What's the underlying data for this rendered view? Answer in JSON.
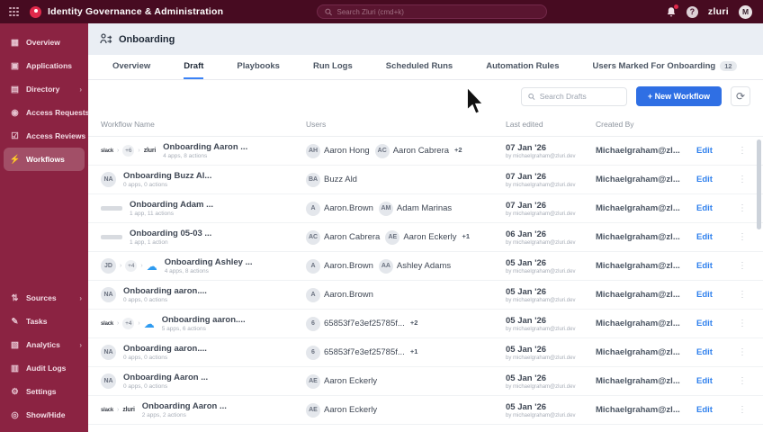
{
  "colors": {
    "topbar": "#470b21",
    "sidebar": "#8b2342",
    "accent_blue": "#2f6fe4",
    "link_blue": "#2f80ed",
    "page_bg": "#eaeef4"
  },
  "topbar": {
    "title": "Identity Governance & Administration",
    "search_placeholder": "Search Zluri (cmd+k)",
    "logo_text": "zluri",
    "avatar_initial": "M"
  },
  "sidebar": {
    "items_top": [
      {
        "label": "Overview",
        "icon": "overview",
        "chevron": false,
        "active": false
      },
      {
        "label": "Applications",
        "icon": "applications",
        "chevron": false,
        "active": false
      },
      {
        "label": "Directory",
        "icon": "directory",
        "chevron": true,
        "active": false
      },
      {
        "label": "Access Requests",
        "icon": "access-requests",
        "chevron": false,
        "active": false
      },
      {
        "label": "Access Reviews",
        "icon": "access-reviews",
        "chevron": false,
        "active": false
      },
      {
        "label": "Workflows",
        "icon": "workflows",
        "chevron": false,
        "active": true
      }
    ],
    "items_bottom": [
      {
        "label": "Sources",
        "icon": "sources",
        "chevron": true,
        "active": false
      },
      {
        "label": "Tasks",
        "icon": "tasks",
        "chevron": false,
        "active": false
      },
      {
        "label": "Analytics",
        "icon": "analytics",
        "chevron": true,
        "active": false
      },
      {
        "label": "Audit Logs",
        "icon": "audit-logs",
        "chevron": false,
        "active": false
      },
      {
        "label": "Settings",
        "icon": "settings",
        "chevron": false,
        "active": false
      },
      {
        "label": "Show/Hide",
        "icon": "show-hide",
        "chevron": false,
        "active": false
      }
    ]
  },
  "page": {
    "title": "Onboarding"
  },
  "tabs": [
    {
      "label": "Overview",
      "active": false
    },
    {
      "label": "Draft",
      "active": true
    },
    {
      "label": "Playbooks",
      "active": false
    },
    {
      "label": "Run Logs",
      "active": false
    },
    {
      "label": "Scheduled Runs",
      "active": false
    },
    {
      "label": "Automation Rules",
      "active": false
    },
    {
      "label": "Users Marked For Onboarding",
      "active": false,
      "badge": "12"
    }
  ],
  "toolbar": {
    "search_placeholder": "Search Drafts",
    "new_workflow_label": "+ New Workflow"
  },
  "table": {
    "columns": [
      "Workflow Name",
      "Users",
      "Last edited",
      "Created By"
    ],
    "edit_label": "Edit",
    "rows": [
      {
        "icons": [
          {
            "t": "wordmark",
            "v": "slack"
          },
          {
            "t": "chev"
          },
          {
            "t": "count",
            "v": "+6"
          },
          {
            "t": "chev"
          },
          {
            "t": "wordmark",
            "v": "zluri"
          }
        ],
        "name": "Onboarding Aaron ...",
        "sub": "4 apps, 8 actions",
        "users": [
          {
            "i": "AH",
            "n": "Aaron Hong"
          },
          {
            "i": "AC",
            "n": "Aaron Cabrera"
          }
        ],
        "extra": "+2",
        "date": "07 Jan '26",
        "date_sub": "by michaelgraham@zluri.dev",
        "created_by": "Michaelgraham@zl..."
      },
      {
        "icons": [
          {
            "t": "avatar",
            "v": "NA"
          }
        ],
        "name": "Onboarding Buzz Al...",
        "sub": "0 apps, 0 actions",
        "users": [
          {
            "i": "BA",
            "n": "Buzz Ald"
          }
        ],
        "extra": "",
        "date": "07 Jan '26",
        "date_sub": "by michaelgraham@zluri.dev",
        "created_by": "Michaelgraham@zl..."
      },
      {
        "icons": [
          {
            "t": "blur"
          }
        ],
        "name": "Onboarding Adam ...",
        "sub": "1 app, 11 actions",
        "users": [
          {
            "i": "A",
            "n": "Aaron.Brown"
          },
          {
            "i": "AM",
            "n": "Adam Marinas"
          }
        ],
        "extra": "",
        "date": "07 Jan '26",
        "date_sub": "by michaelgraham@zluri.dev",
        "created_by": "Michaelgraham@zl..."
      },
      {
        "icons": [
          {
            "t": "blur"
          }
        ],
        "name": "Onboarding 05-03 ...",
        "sub": "1 app, 1 action",
        "users": [
          {
            "i": "AC",
            "n": "Aaron Cabrera"
          },
          {
            "i": "AE",
            "n": "Aaron Eckerly"
          }
        ],
        "extra": "+1",
        "date": "06 Jan '26",
        "date_sub": "by michaelgraham@zluri.dev",
        "created_by": "Michaelgraham@zl..."
      },
      {
        "icons": [
          {
            "t": "avatar",
            "v": "JD"
          },
          {
            "t": "chev"
          },
          {
            "t": "count",
            "v": "+4"
          },
          {
            "t": "chev"
          },
          {
            "t": "cloud"
          }
        ],
        "name": "Onboarding Ashley ...",
        "sub": "4 apps, 8 actions",
        "users": [
          {
            "i": "A",
            "n": "Aaron.Brown"
          },
          {
            "i": "AA",
            "n": "Ashley Adams"
          }
        ],
        "extra": "",
        "date": "05 Jan '26",
        "date_sub": "by michaelgraham@zluri.dev",
        "created_by": "Michaelgraham@zl..."
      },
      {
        "icons": [
          {
            "t": "avatar",
            "v": "NA"
          }
        ],
        "name": "Onboarding aaron....",
        "sub": "0 apps, 0 actions",
        "users": [
          {
            "i": "A",
            "n": "Aaron.Brown"
          }
        ],
        "extra": "",
        "date": "05 Jan '26",
        "date_sub": "by michaelgraham@zluri.dev",
        "created_by": "Michaelgraham@zl..."
      },
      {
        "icons": [
          {
            "t": "wordmark",
            "v": "slack"
          },
          {
            "t": "chev"
          },
          {
            "t": "count",
            "v": "+4"
          },
          {
            "t": "chev"
          },
          {
            "t": "cloud"
          }
        ],
        "name": "Onboarding aaron....",
        "sub": "5 apps, 6 actions",
        "users": [
          {
            "i": "6",
            "n": "65853f7e3ef25785f..."
          }
        ],
        "extra": "+2",
        "date": "05 Jan '26",
        "date_sub": "by michaelgraham@zluri.dev",
        "created_by": "Michaelgraham@zl..."
      },
      {
        "icons": [
          {
            "t": "avatar",
            "v": "NA"
          }
        ],
        "name": "Onboarding aaron....",
        "sub": "0 apps, 0 actions",
        "users": [
          {
            "i": "6",
            "n": "65853f7e3ef25785f..."
          }
        ],
        "extra": "+1",
        "date": "05 Jan '26",
        "date_sub": "by michaelgraham@zluri.dev",
        "created_by": "Michaelgraham@zl..."
      },
      {
        "icons": [
          {
            "t": "avatar",
            "v": "NA"
          }
        ],
        "name": "Onboarding Aaron ...",
        "sub": "0 apps, 0 actions",
        "users": [
          {
            "i": "AE",
            "n": "Aaron Eckerly"
          }
        ],
        "extra": "",
        "date": "05 Jan '26",
        "date_sub": "by michaelgraham@zluri.dev",
        "created_by": "Michaelgraham@zl..."
      },
      {
        "icons": [
          {
            "t": "wordmark",
            "v": "slack"
          },
          {
            "t": "chev"
          },
          {
            "t": "wordmark",
            "v": "zluri"
          }
        ],
        "name": "Onboarding Aaron ...",
        "sub": "2 apps, 2 actions",
        "users": [
          {
            "i": "AE",
            "n": "Aaron Eckerly"
          }
        ],
        "extra": "",
        "date": "05 Jan '26",
        "date_sub": "by michaelgraham@zluri.dev",
        "created_by": "Michaelgraham@zl..."
      }
    ]
  }
}
